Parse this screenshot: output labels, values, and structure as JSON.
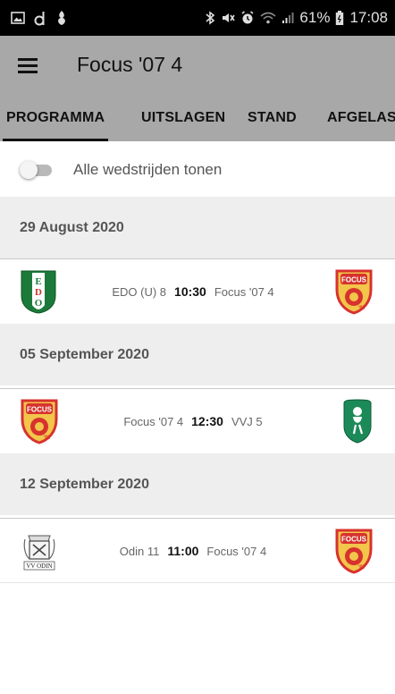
{
  "status_bar": {
    "left_icons": [
      "gallery-icon",
      "d-icon",
      "app-icon"
    ],
    "battery": "61%",
    "time": "17:08"
  },
  "app_bar": {
    "title": "Focus '07 4"
  },
  "tabs": [
    {
      "label": "PROGRAMMA",
      "active": true
    },
    {
      "label": "UITSLAGEN",
      "active": false
    },
    {
      "label": "STAND",
      "active": false
    },
    {
      "label": "AFGELAST",
      "active": false
    }
  ],
  "toggle": {
    "label": "Alle wedstrijden tonen",
    "on": false
  },
  "sections": [
    {
      "date": "29 August 2020",
      "match": {
        "home": "EDO (U) 8",
        "time": "10:30",
        "away": "Focus '07 4",
        "home_logo": "edo-logo",
        "away_logo": "focus-logo"
      }
    },
    {
      "date": "05 September 2020",
      "match": {
        "home": "Focus '07 4",
        "time": "12:30",
        "away": "VVJ 5",
        "home_logo": "focus-logo",
        "away_logo": "vvj-logo"
      }
    },
    {
      "date": "12 September 2020",
      "match": {
        "home": "Odin 11",
        "time": "11:00",
        "away": "Focus '07 4",
        "home_logo": "odin-logo",
        "away_logo": "focus-logo",
        "home_logo_text": "VV ODIN"
      }
    }
  ],
  "logo_texts": {
    "edo": [
      "E",
      "D",
      "O"
    ],
    "focus_top": "FOCUS",
    "focus_bottom": "'07"
  },
  "colors": {
    "app_bar": "#a8a8a8",
    "header_bg": "#eeeeee",
    "edo_green": "#1b7a3a",
    "focus_red": "#d7322e",
    "focus_yellow": "#f2c54b",
    "vvj_green": "#1c8a58"
  }
}
